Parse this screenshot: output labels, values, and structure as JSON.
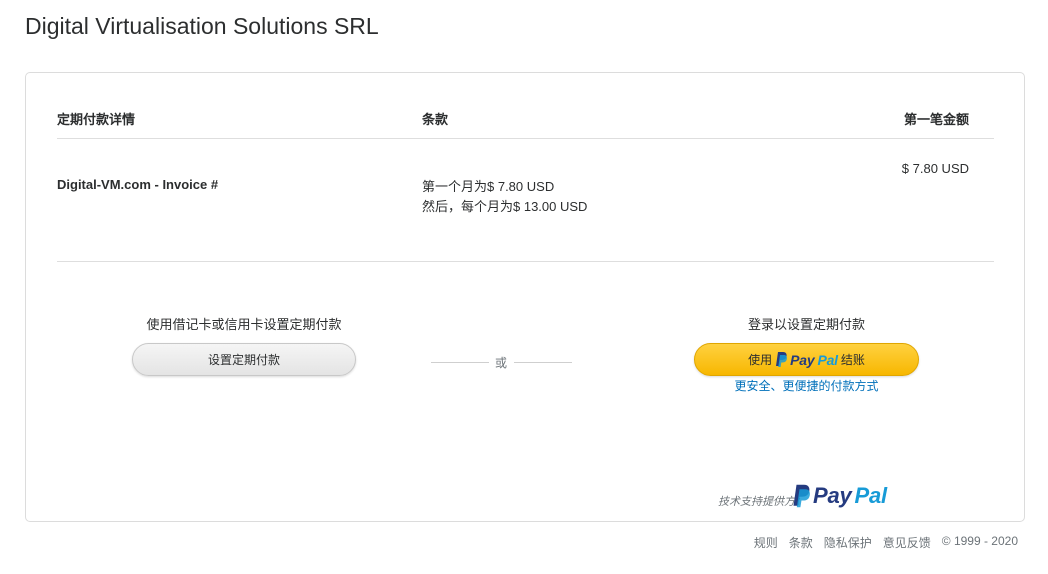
{
  "merchant": {
    "name": "Digital Virtualisation Solutions SRL"
  },
  "table": {
    "headers": {
      "details": "定期付款详情",
      "terms": "条款",
      "first_amount": "第一笔金额"
    },
    "rows": [
      {
        "description": "Digital-VM.com - Invoice #",
        "terms": [
          "第一个月为$ 7.80 USD",
          "然后，每个月为$ 13.00 USD"
        ],
        "amount": "$ 7.80 USD"
      }
    ]
  },
  "card_option": {
    "caption": "使用借记卡或信用卡设置定期付款",
    "button_label": "设置定期付款"
  },
  "separator": {
    "text": "或"
  },
  "paypal_option": {
    "caption": "登录以设置定期付款",
    "button_prefix": "使用",
    "logo_pay": "Pay",
    "logo_pal": "Pal",
    "button_suffix": "结账",
    "subtext": "更安全、更便捷的付款方式"
  },
  "powered_by": {
    "label": "技术支持提供方：",
    "logo_pay": "Pay",
    "logo_pal": "Pal"
  },
  "footer": {
    "links": [
      "规则",
      "条款",
      "隐私保护",
      "意见反馈"
    ],
    "copyright": "© 1999 - 2020"
  },
  "colors": {
    "paypal_yellow": "#ffc439",
    "paypal_dark_blue": "#253b80",
    "paypal_light_blue": "#179bd7",
    "link_blue": "#0070ba"
  }
}
